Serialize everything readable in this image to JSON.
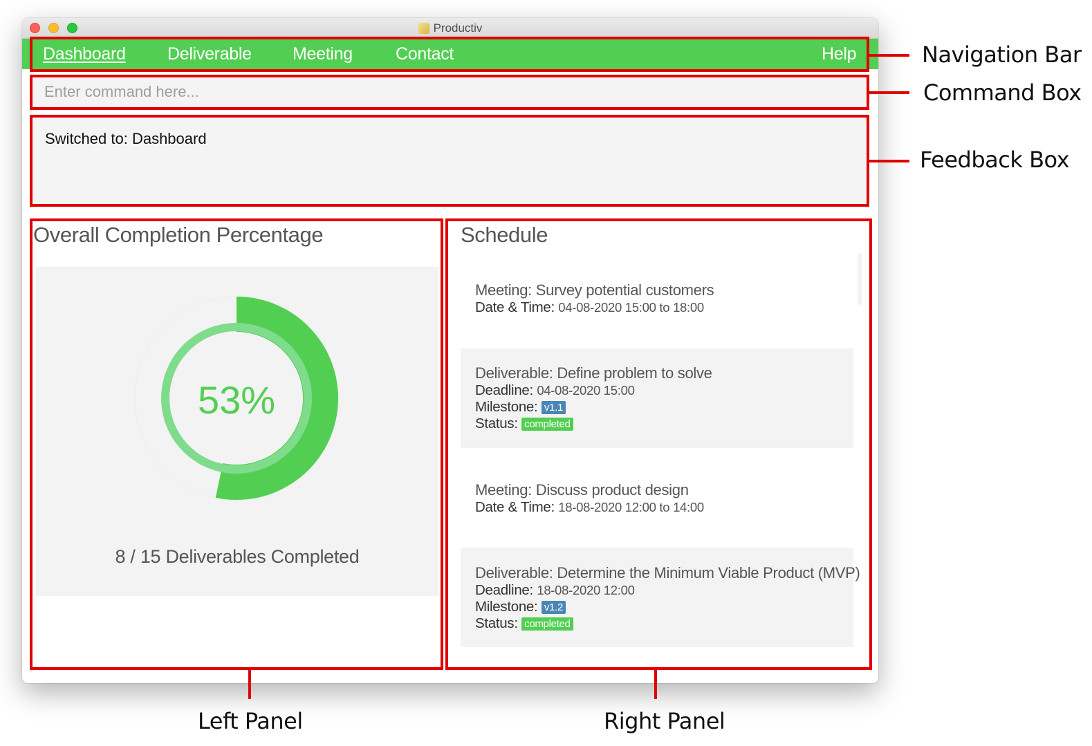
{
  "window": {
    "title": "Productiv",
    "app_icon": "app-icon"
  },
  "nav": {
    "items": [
      "Dashboard",
      "Deliverable",
      "Meeting",
      "Contact"
    ],
    "help": "Help",
    "active": "Dashboard",
    "bg_color": "#52cf52"
  },
  "command": {
    "placeholder": "Enter command here...",
    "value": ""
  },
  "feedback": {
    "text": "Switched to: Dashboard"
  },
  "left_panel": {
    "title": "Overall Completion Percentage",
    "percent_label": "53%",
    "completion_fraction": 0.533,
    "completed_text": "8 / 15 Deliverables Completed",
    "colors": {
      "arc": "#52cf52",
      "inner_ring": "#7fdc8c",
      "track": "#e8f5ea",
      "text": "#52cf52"
    }
  },
  "right_panel": {
    "title": "Schedule",
    "items": [
      {
        "type": "meeting",
        "title": "Meeting: Survey potential customers",
        "date_key": "Date & Time:",
        "date_value": "04-08-2020 15:00 to 18:00"
      },
      {
        "type": "deliverable",
        "title": "Deliverable: Define problem to solve",
        "deadline_key": "Deadline:",
        "deadline_value": "04-08-2020 15:00",
        "milestone_key": "Milestone:",
        "milestone": "v1.1",
        "status_key": "Status:",
        "status": "completed"
      },
      {
        "type": "meeting",
        "title": "Meeting: Discuss product design",
        "date_key": "Date & Time:",
        "date_value": "18-08-2020 12:00 to 14:00"
      },
      {
        "type": "deliverable",
        "title": "Deliverable: Determine the Minimum Viable Product (MVP)",
        "deadline_key": "Deadline:",
        "deadline_value": "18-08-2020 12:00",
        "milestone_key": "Milestone:",
        "milestone": "v1.2",
        "status_key": "Status:",
        "status": "completed"
      }
    ]
  },
  "annotations": {
    "navigation_bar": "Navigation Bar",
    "command_box": "Command Box",
    "feedback_box": "Feedback Box",
    "left_panel": "Left Panel",
    "right_panel": "Right Panel",
    "color": "#e00000"
  }
}
